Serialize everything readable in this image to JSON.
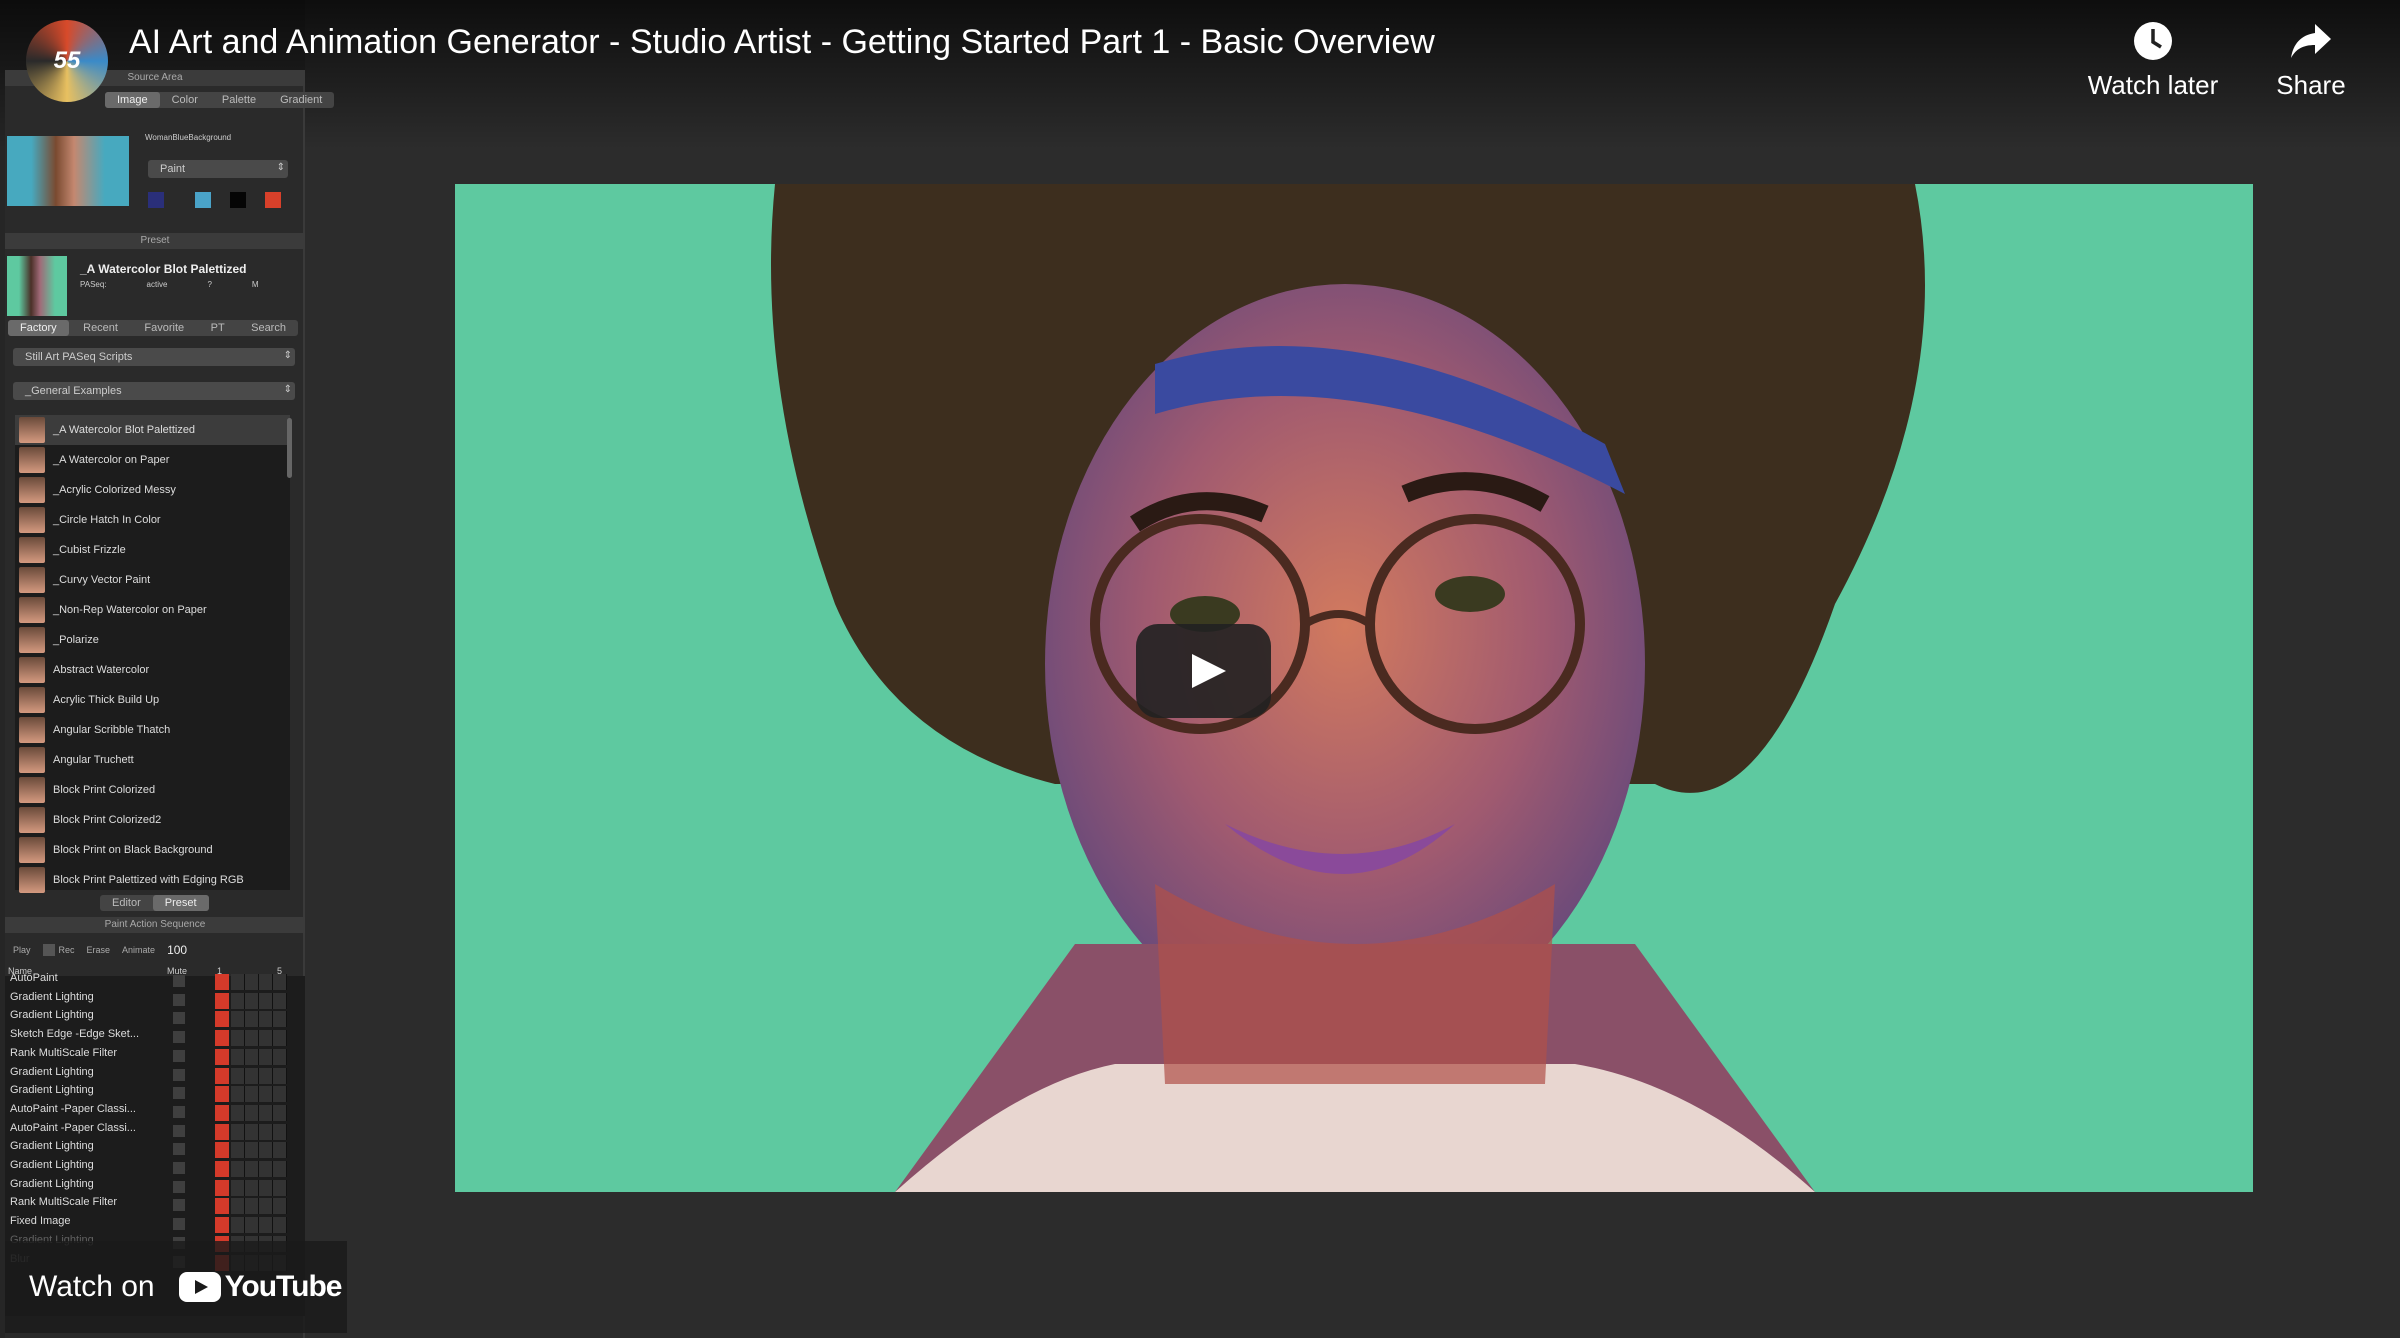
{
  "video": {
    "title": "AI Art and Animation Generator - Studio Artist - Getting Started Part 1 - Basic Overview",
    "channel_avatar_text": "55",
    "watch_later": "Watch later",
    "share": "Share",
    "watch_on": "Watch on",
    "youtube": "YouTube"
  },
  "app": {
    "source_area": {
      "header": "Source Area",
      "tabs": [
        "Image",
        "Color",
        "Palette",
        "Gradient"
      ],
      "active_tab": "Image",
      "source_name": "WomanBlueBackground",
      "mode": "Paint",
      "swatches": [
        "#2a2f7a",
        "#4aa3c8",
        "#050505",
        "#d8402a"
      ]
    },
    "preset": {
      "header": "Preset",
      "name": "_A Watercolor Blot Palettized",
      "paseq_label": "PASeq:",
      "paseq_status": "active",
      "q": "?",
      "m": "M",
      "tabs": [
        "Factory",
        "Recent",
        "Favorite",
        "PT",
        "Search"
      ],
      "active_tab": "Factory",
      "category": "Still Art PASeq Scripts",
      "subcategory": "_General Examples",
      "items": [
        "_A Watercolor Blot Palettized",
        "_A Watercolor on Paper",
        "_Acrylic Colorized Messy",
        "_Circle Hatch In Color",
        "_Cubist Frizzle",
        "_Curvy Vector Paint",
        "_Non-Rep Watercolor on Paper",
        "_Polarize",
        "Abstract Watercolor",
        "Acrylic Thick Build Up",
        "Angular Scribble Thatch",
        "Angular Truchett",
        "Block Print Colorized",
        "Block Print Colorized2",
        "Block Print on Black Background",
        "Block Print Palettized with Edging RGB"
      ],
      "bottom_tabs": [
        "Editor",
        "Preset"
      ],
      "bottom_active": "Preset"
    },
    "pas": {
      "header": "Paint Action Sequence",
      "play": "Play",
      "rec": "Rec",
      "erase": "Erase",
      "animate": "Animate",
      "animate_value": "100",
      "col_name": "Name",
      "col_mute": "Mute",
      "timeline_start": "1",
      "timeline_end": "5",
      "rows": [
        "AutoPaint",
        "Gradient Lighting",
        "Gradient Lighting",
        "Sketch Edge -Edge Sket...",
        "Rank MultiScale Filter",
        "Gradient Lighting",
        "Gradient Lighting",
        "AutoPaint -Paper Classi...",
        "AutoPaint -Paper Classi...",
        "Gradient Lighting",
        "Gradient Lighting",
        "Gradient Lighting",
        "Rank MultiScale Filter",
        "Fixed Image",
        "Gradient Lighting",
        "Blur"
      ]
    }
  },
  "colors": {
    "canvas_bg": "#5ec9a0",
    "accent_red": "#d43a2a",
    "youtube_red": "#ff0000"
  }
}
